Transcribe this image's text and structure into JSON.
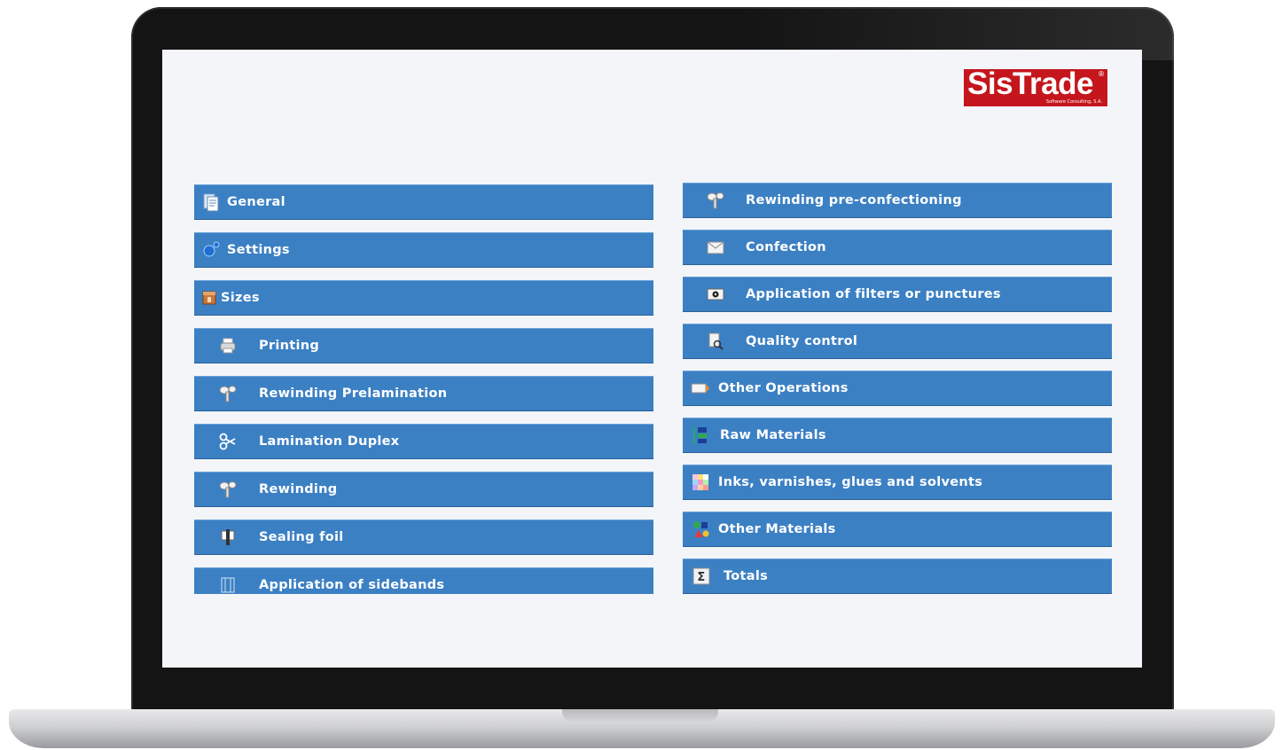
{
  "app": {
    "logo": {
      "name": "SisTrade",
      "reg": "®",
      "tagline": "Software Consulting, S.A."
    }
  },
  "left_menu": [
    {
      "label": "General",
      "icon": "documents-icon"
    },
    {
      "label": "Settings",
      "icon": "gears-icon"
    },
    {
      "label": "Sizes",
      "icon": "box-icon"
    },
    {
      "label": "Printing",
      "icon": "printer-icon"
    },
    {
      "label": "Rewinding Prelamination",
      "icon": "rewind-icon"
    },
    {
      "label": "Lamination Duplex",
      "icon": "scissors-icon"
    },
    {
      "label": "Rewinding",
      "icon": "rewind-icon"
    },
    {
      "label": "Sealing foil",
      "icon": "seal-icon"
    },
    {
      "label": "Application of sidebands",
      "icon": "sidebands-icon"
    }
  ],
  "right_menu": [
    {
      "label": "Rewinding pre-confectioning",
      "icon": "rewind-icon"
    },
    {
      "label": "Confection",
      "icon": "envelope-icon"
    },
    {
      "label": "Application of filters or punctures",
      "icon": "eye-icon"
    },
    {
      "label": "Quality control",
      "icon": "inspect-icon"
    },
    {
      "label": "Other Operations",
      "icon": "tag-icon"
    },
    {
      "label": "Raw Materials",
      "icon": "materials-icon"
    },
    {
      "label": "Inks, varnishes, glues and solvents",
      "icon": "palette-icon"
    },
    {
      "label": "Other Materials",
      "icon": "shapes-icon"
    },
    {
      "label": "Totals",
      "icon": "sigma-icon"
    }
  ],
  "colors": {
    "button": "#3c80c4",
    "logo": "#c4161c",
    "screen_bg": "#f3f5f8"
  }
}
